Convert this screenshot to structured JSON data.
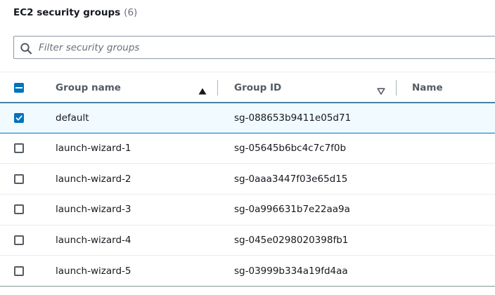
{
  "title": {
    "text": "EC2 security groups",
    "count": "(6)"
  },
  "filter": {
    "placeholder": "Filter security groups",
    "value": ""
  },
  "columns": {
    "group_name": "Group name",
    "group_id": "Group ID",
    "name": "Name"
  },
  "rows": [
    {
      "group_name": "default",
      "group_id": "sg-088653b9411e05d71",
      "selected": true
    },
    {
      "group_name": "launch-wizard-1",
      "group_id": "sg-05645b6bc4c7c7f0b",
      "selected": false
    },
    {
      "group_name": "launch-wizard-2",
      "group_id": "sg-0aaa3447f03e65d15",
      "selected": false
    },
    {
      "group_name": "launch-wizard-3",
      "group_id": "sg-0a996631b7e22aa9a",
      "selected": false
    },
    {
      "group_name": "launch-wizard-4",
      "group_id": "sg-045e0298020398fb1",
      "selected": false
    },
    {
      "group_name": "launch-wizard-5",
      "group_id": "sg-03999b334a19fd4aa",
      "selected": false
    }
  ],
  "icons": {
    "search": "search-icon",
    "sort_ascending": "sort-ascending-icon",
    "sort_descending": "sort-descending-icon",
    "checkmark": "checkmark-icon"
  },
  "colors": {
    "accent": "#0073bb",
    "selected_row_bg": "#f1faff",
    "text": "#16191f",
    "muted": "#687078"
  }
}
